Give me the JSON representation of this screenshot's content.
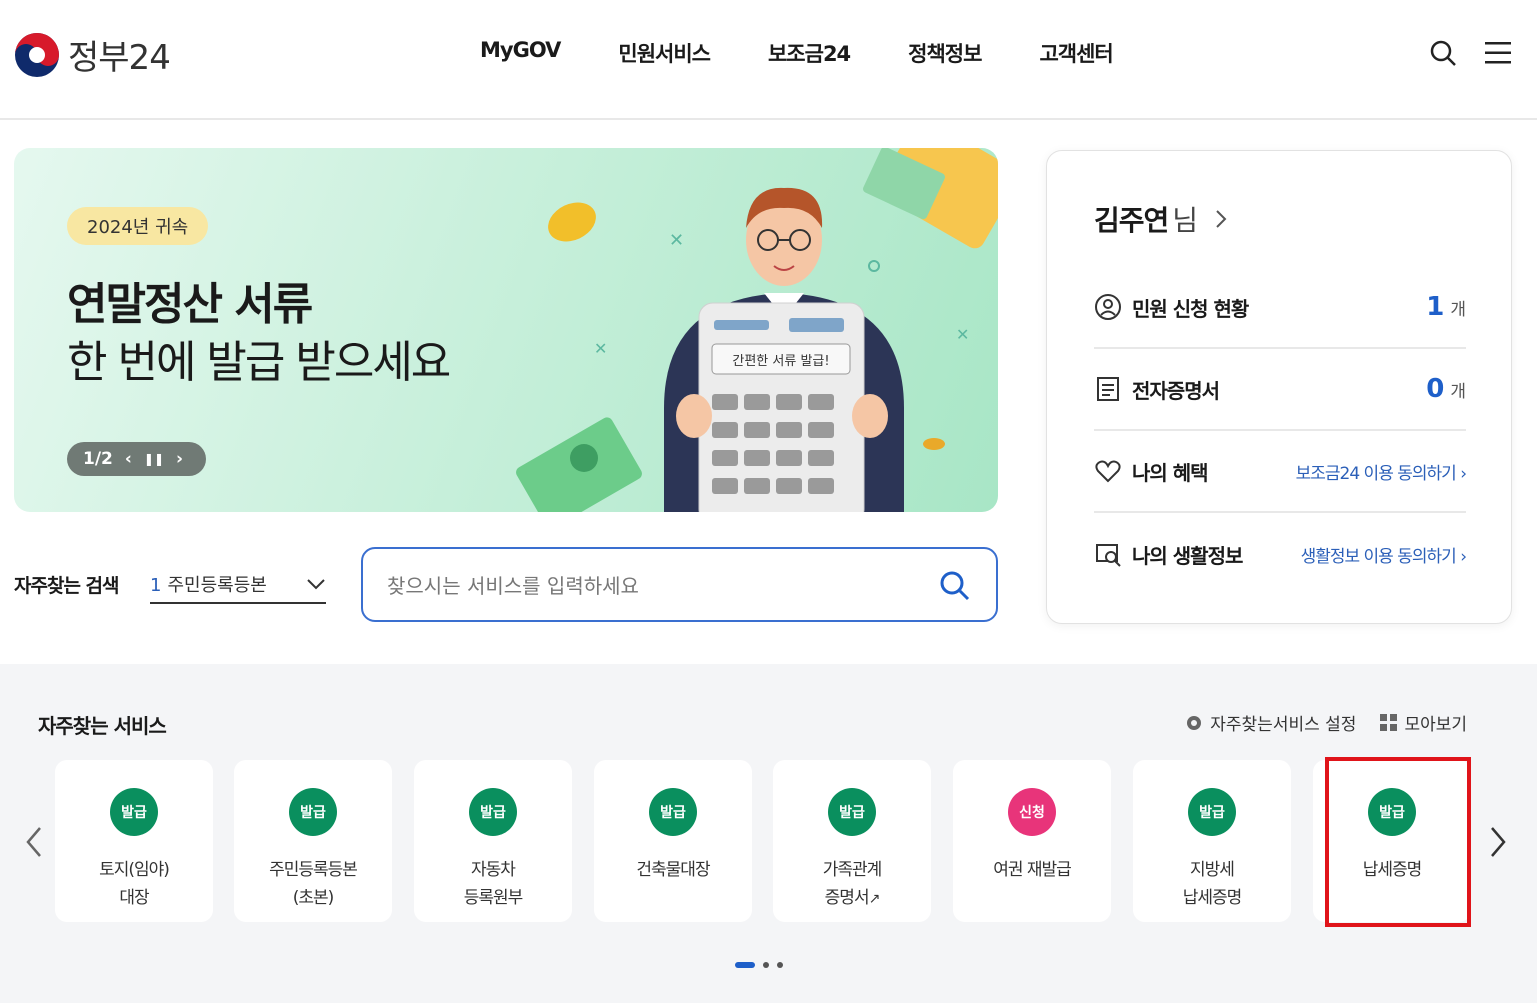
{
  "header": {
    "logo_text": "정부24",
    "nav": [
      "MyGOV",
      "민원서비스",
      "보조금24",
      "정책정보",
      "고객센터"
    ],
    "icons": [
      "search-icon",
      "menu-icon"
    ]
  },
  "banner": {
    "badge": "2024년 귀속",
    "title_line1": "연말정산 서류",
    "title_line2": "한 번에 발급 받으세요",
    "pager": "1/2",
    "calculator_text": "간편한 서류 발급!"
  },
  "search": {
    "freq_label": "자주찾는 검색",
    "freq_num": "1",
    "freq_value": "주민등록등본",
    "placeholder": "찾으시는 서비스를 입력하세요"
  },
  "user": {
    "name": "김주연",
    "suffix": "님",
    "rows": [
      {
        "label": "민원 신청 현황",
        "count": "1",
        "unit": "개"
      },
      {
        "label": "전자증명서",
        "count": "0",
        "unit": "개"
      },
      {
        "label": "나의 혜택",
        "link": "보조금24 이용 동의하기"
      },
      {
        "label": "나의 생활정보",
        "link": "생활정보 이용 동의하기"
      }
    ]
  },
  "services": {
    "title": "자주찾는 서비스",
    "settings": "자주찾는서비스 설정",
    "view_all": "모아보기",
    "cards": [
      {
        "tag": "발급",
        "label": "토지(임야)\n대장"
      },
      {
        "tag": "발급",
        "label": "주민등록등본\n(초본)"
      },
      {
        "tag": "발급",
        "label": "자동차\n등록원부"
      },
      {
        "tag": "발급",
        "label": "건축물대장"
      },
      {
        "tag": "발급",
        "label": "가족관계\n증명서"
      },
      {
        "tag": "신청",
        "label": "여권 재발급"
      },
      {
        "tag": "발급",
        "label": "지방세\n납세증명"
      },
      {
        "tag": "발급",
        "label": "납세증명"
      }
    ],
    "colors": {
      "issue": "#0a8f5e",
      "apply": "#e8347a",
      "highlight": "#e0141a"
    }
  }
}
